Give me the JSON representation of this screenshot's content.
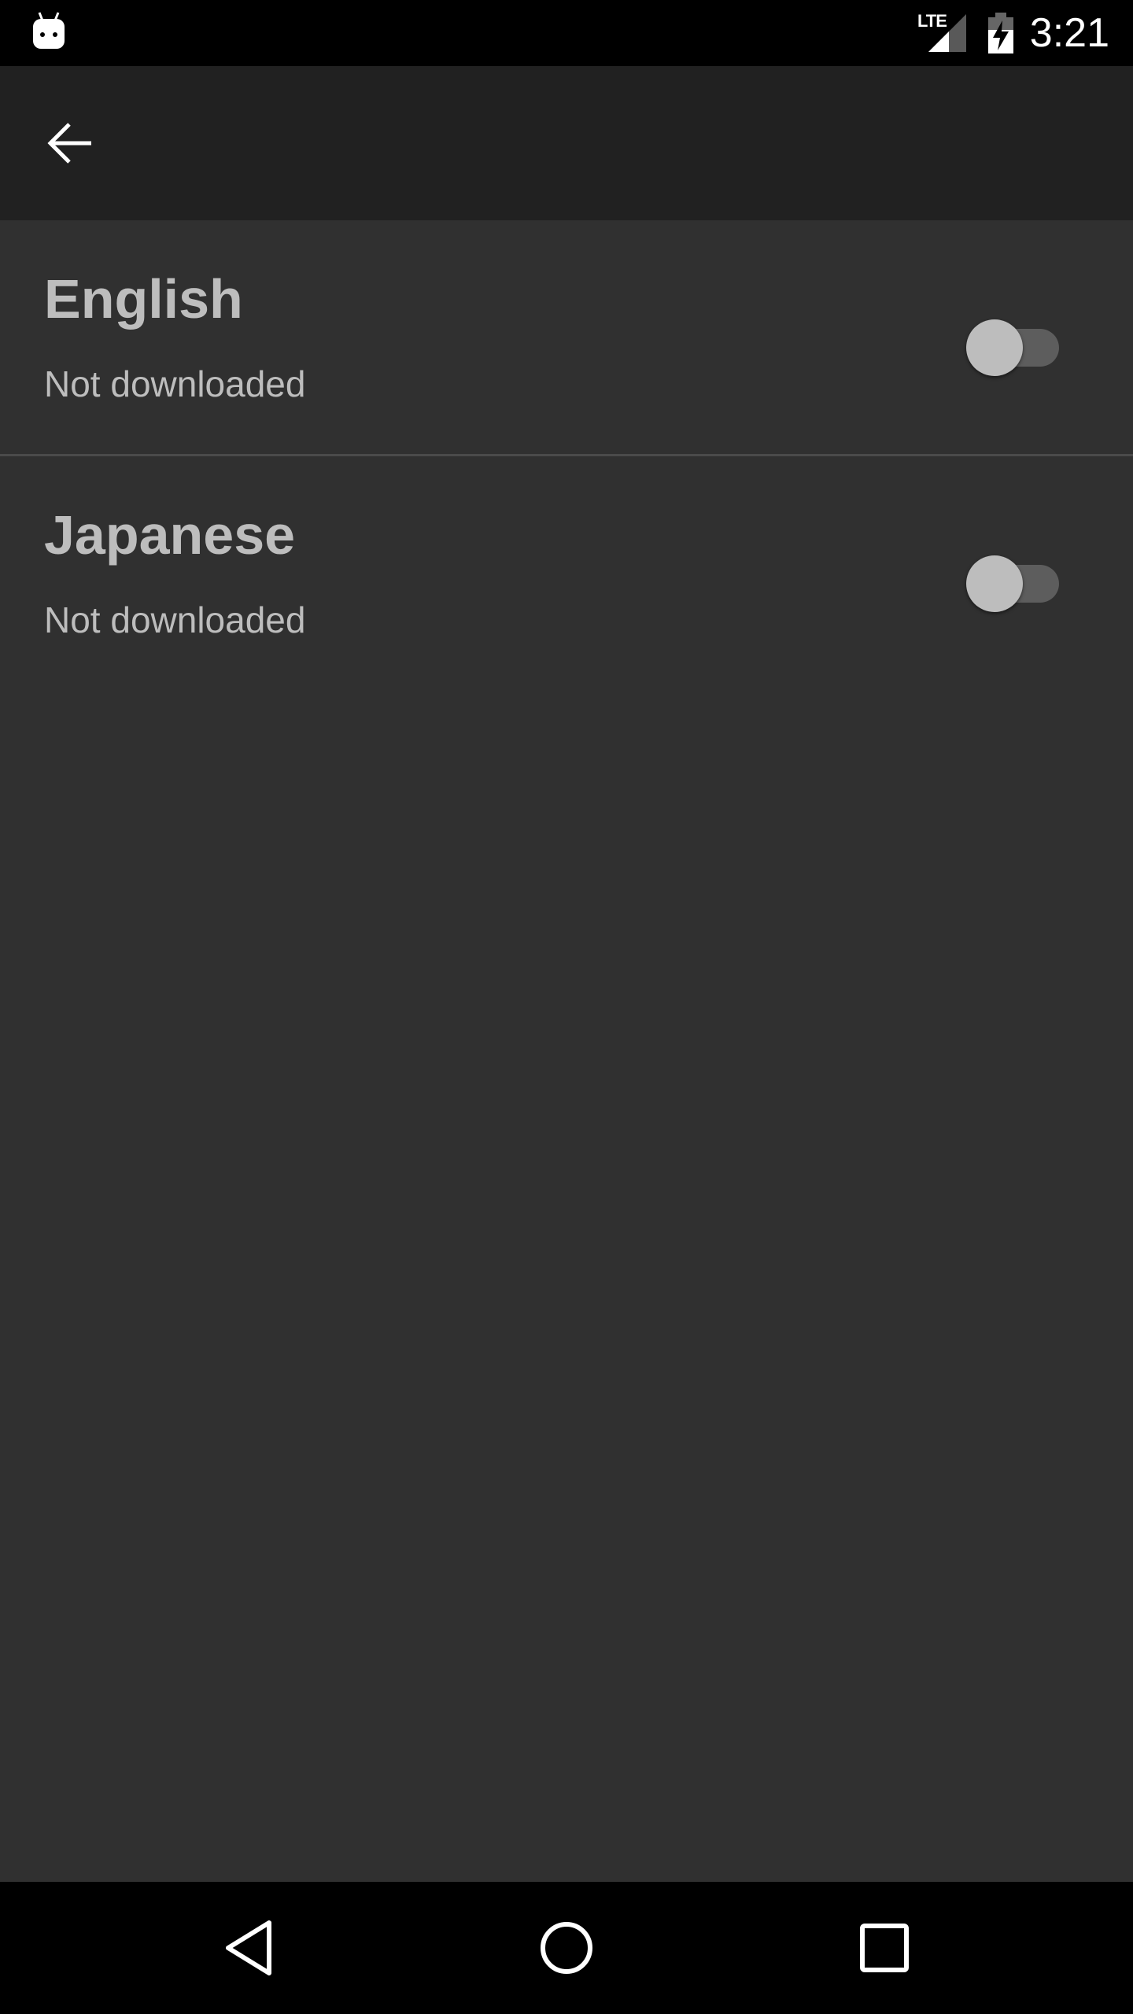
{
  "status_bar": {
    "time": "3:21",
    "network_label": "LTE",
    "icons": [
      "android-notification-icon",
      "lte-signal-icon",
      "battery-charging-icon"
    ]
  },
  "app_bar": {
    "back_icon": "arrow-back-icon"
  },
  "languages": [
    {
      "name": "English",
      "status": "Not downloaded",
      "enabled": false
    },
    {
      "name": "Japanese",
      "status": "Not downloaded",
      "enabled": false
    }
  ],
  "nav_bar": {
    "icons": [
      "nav-back-icon",
      "nav-home-icon",
      "nav-recents-icon"
    ]
  },
  "colors": {
    "background": "#303030",
    "app_bar": "#212121",
    "text": "#bdbdbd",
    "divider": "#4a4a4a",
    "switch_track": "#5d5d5d",
    "switch_thumb": "#bdbdbd"
  }
}
